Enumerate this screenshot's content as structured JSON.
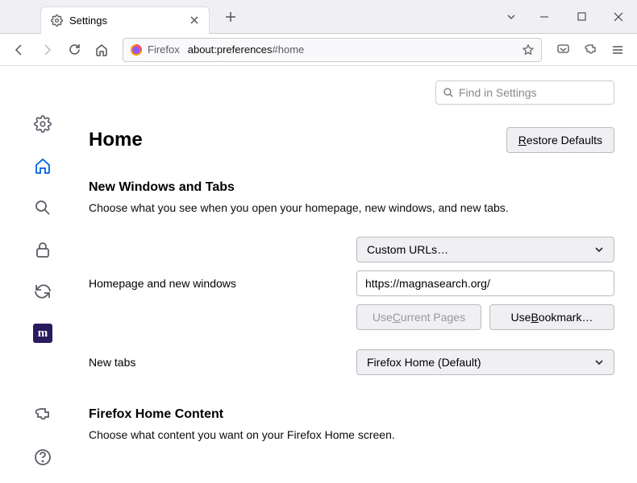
{
  "window": {
    "tab_title": "Settings",
    "newtab_plus": "+"
  },
  "toolbar": {
    "identity_label": "Firefox",
    "url_prefix": "about:preferences",
    "url_hash": "#home"
  },
  "search": {
    "placeholder": "Find in Settings"
  },
  "page": {
    "title": "Home",
    "restore_btn_pre": "R",
    "restore_btn_rest": "estore Defaults"
  },
  "section1": {
    "heading": "New Windows and Tabs",
    "desc": "Choose what you see when you open your homepage, new windows, and new tabs.",
    "dropdown1": "Custom URLs…",
    "row1_label": "Homepage and new windows",
    "url_value": "https://magnasearch.org/",
    "use_current_pre": "Use ",
    "use_current_u": "C",
    "use_current_post": "urrent Pages",
    "use_bookmark_pre": "Use ",
    "use_bookmark_u": "B",
    "use_bookmark_post": "ookmark…",
    "row2_label": "New tabs",
    "dropdown2": "Firefox Home (Default)"
  },
  "section2": {
    "heading": "Firefox Home Content",
    "desc": "Choose what content you want on your Firefox Home screen."
  },
  "sidebar": {
    "ext_badge": "m"
  }
}
